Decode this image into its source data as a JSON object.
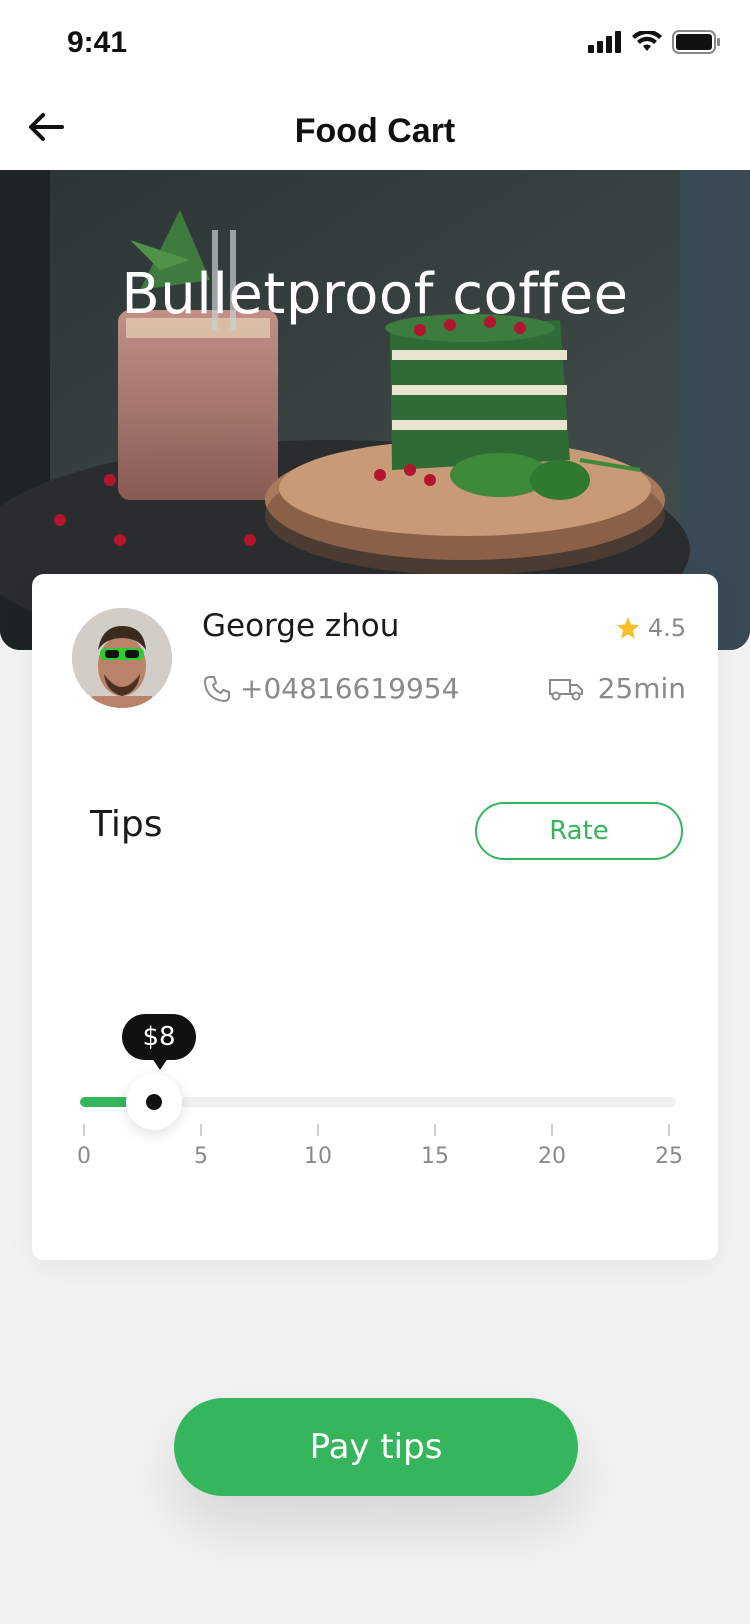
{
  "status_bar": {
    "time": "9:41"
  },
  "nav": {
    "title": "Food Cart"
  },
  "hero": {
    "title": "Bulletproof coffee"
  },
  "driver": {
    "name": "George zhou",
    "rating": "4.5",
    "phone": "+04816619954",
    "eta": "25min"
  },
  "tips": {
    "label": "Tips",
    "rate_label": "Rate",
    "selected_label": "$8",
    "selected_value": 3,
    "min": 0,
    "max": 25,
    "ticks": [
      "0",
      "5",
      "10",
      "15",
      "20",
      "25"
    ]
  },
  "pay_button": {
    "label": "Pay tips"
  },
  "colors": {
    "accent": "#35b55c",
    "star": "#f5c02b"
  },
  "icons": [
    "back-arrow-icon",
    "signal-icon",
    "wifi-icon",
    "battery-icon",
    "star-icon",
    "phone-icon",
    "truck-icon"
  ]
}
